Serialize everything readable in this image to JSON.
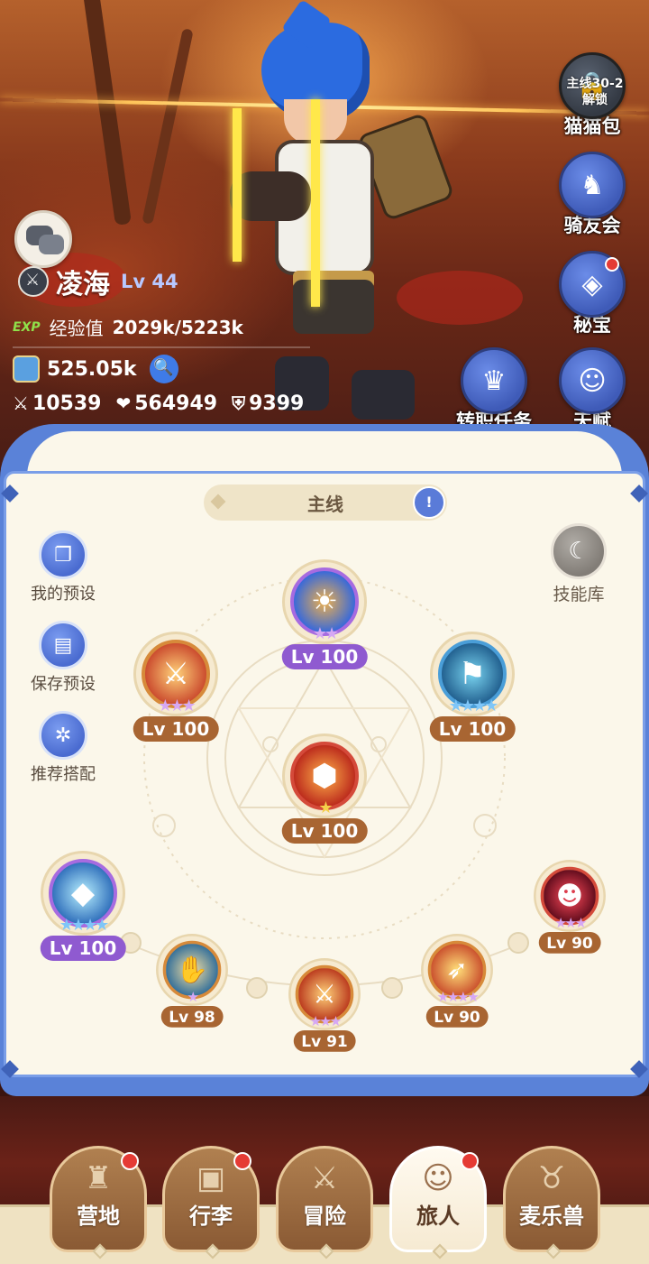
{
  "player": {
    "name": "凌海",
    "level": "Lv 44",
    "exp_tag": "EXP",
    "exp_label": "经验值",
    "exp_value": "2029k/5223k",
    "power": "525.05k",
    "attack": "10539",
    "hp": "564949",
    "defense": "9399"
  },
  "side_menu": {
    "cat_bag_lock": "主线30-2 解锁",
    "cat_bag": "猫猫包",
    "rider_club": "骑友会",
    "treasure": "秘宝",
    "job_quest": "转职任务",
    "talent": "天赋"
  },
  "panel": {
    "tab": "主线",
    "my_preset": "我的预设",
    "save_preset": "保存预设",
    "recommend": "推荐搭配",
    "skill_library": "技能库"
  },
  "skills": [
    {
      "level": "Lv 100",
      "stars": "★★"
    },
    {
      "level": "Lv 100",
      "stars": "★★★"
    },
    {
      "level": "Lv 100",
      "stars": "★★★★"
    },
    {
      "level": "Lv 100",
      "stars": "★"
    },
    {
      "level": "Lv 100",
      "stars": "★★★★"
    },
    {
      "level": "Lv 90",
      "stars": "★★★"
    },
    {
      "level": "Lv 98",
      "stars": "★"
    },
    {
      "level": "Lv 91",
      "stars": "★★★"
    },
    {
      "level": "Lv 90",
      "stars": "★★★★"
    }
  ],
  "nav": {
    "camp": "营地",
    "luggage": "行李",
    "adventure": "冒险",
    "traveler": "旅人",
    "pet": "麦乐兽"
  },
  "colors": {
    "panel_bg": "#fbf7ea",
    "frame_blue": "#5a82d8",
    "orange_level": "#a86532",
    "purple_level": "#8f5ad0",
    "notice_red": "#e53b35"
  }
}
